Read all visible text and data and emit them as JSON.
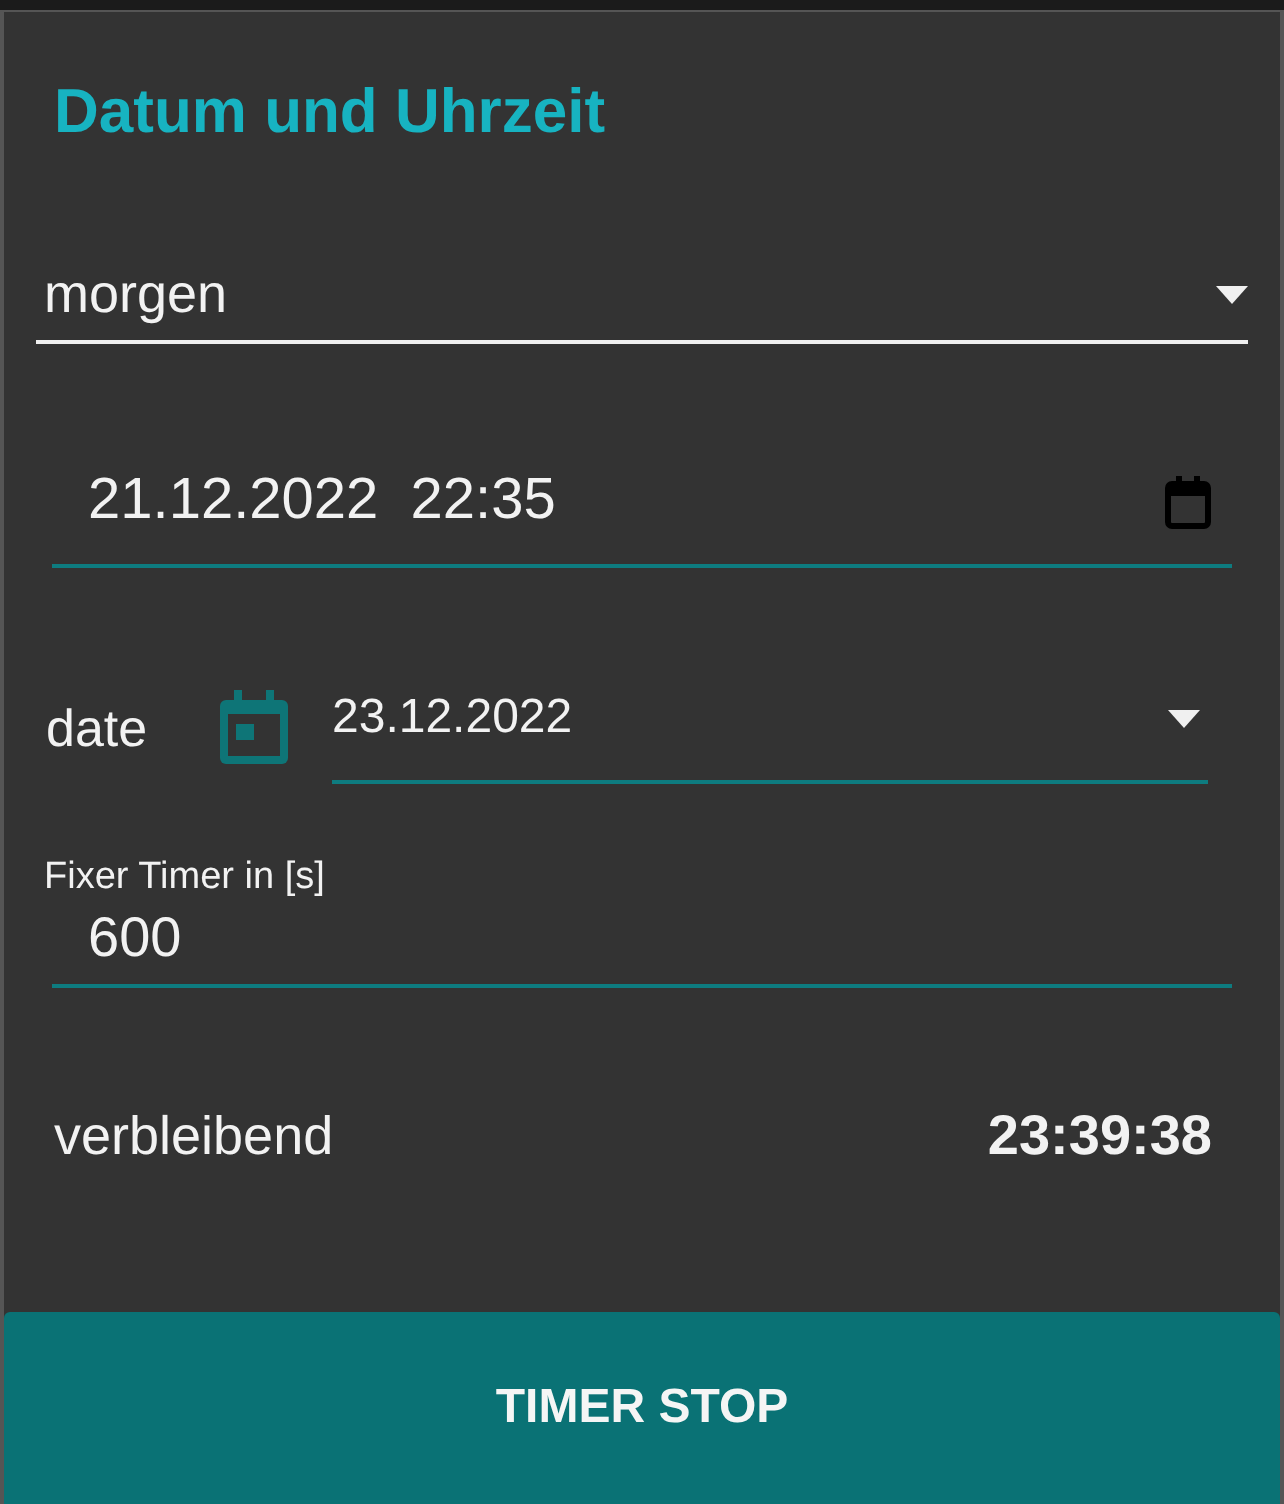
{
  "title": "Datum und Uhrzeit",
  "mode_select": {
    "value": "morgen"
  },
  "datetime_field": {
    "value": "21.12.2022  22:35"
  },
  "date_row": {
    "label": "date",
    "value": "23.12.2022"
  },
  "timer_field": {
    "label": "Fixer Timer in [s]",
    "value": "600"
  },
  "remaining": {
    "label": "verbleibend",
    "value": "23:39:38"
  },
  "button": {
    "label": "TIMER STOP"
  }
}
